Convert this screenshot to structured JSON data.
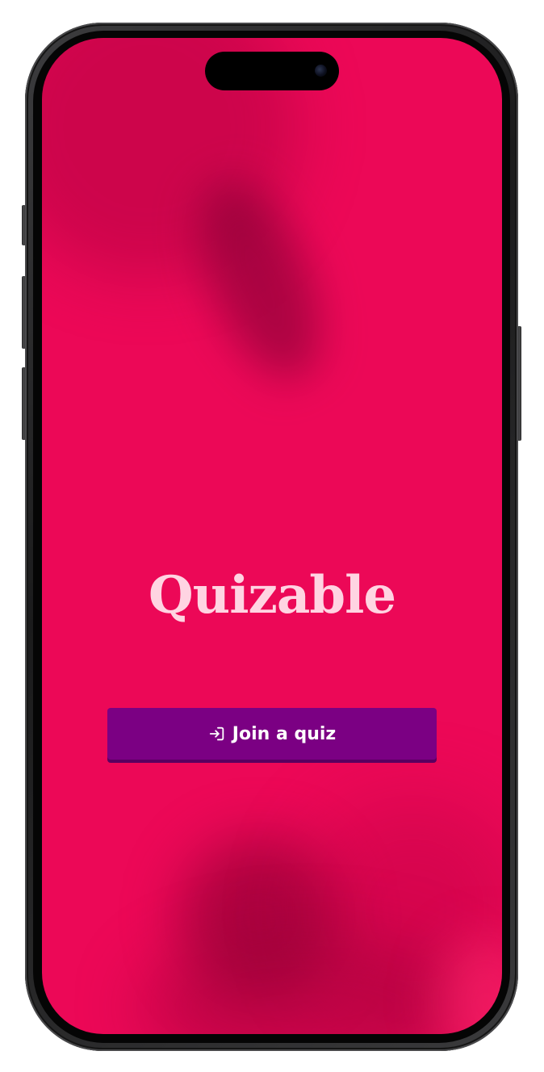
{
  "app": {
    "title": "Quizable"
  },
  "actions": {
    "join_label": "Join a quiz",
    "join_icon": "enter-icon"
  },
  "colors": {
    "background": "#ec0857",
    "title_text": "#ffd4e2",
    "button_background": "#7b0083",
    "button_text": "#ffffff"
  }
}
